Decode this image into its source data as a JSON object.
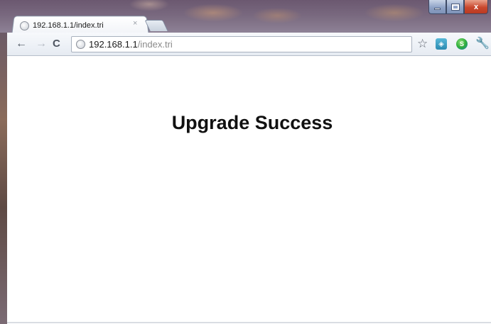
{
  "browser": {
    "tab": {
      "title": "192.168.1.1/index.tri",
      "close_glyph": "×",
      "favicon": "globe-icon"
    },
    "new_tab_icon": "new-tab-icon",
    "window_controls": {
      "minimize_icon": "minimize-icon",
      "maximize_icon": "maximize-icon",
      "close_glyph": "x"
    },
    "toolbar": {
      "back_glyph": "←",
      "forward_glyph": "→",
      "reload_glyph": "C",
      "url_host": "192.168.1.1",
      "url_path": "/index.tri",
      "bookmark_star_glyph": "☆",
      "extension1_icon": "extension-icon",
      "extension2_icon": "extension-icon",
      "wrench_glyph": "🔧"
    }
  },
  "page": {
    "heading": "Upgrade Success"
  },
  "colors": {
    "close_button": "#c9482e",
    "window_chrome": "#8fa3c7",
    "page_background": "#ffffff"
  }
}
